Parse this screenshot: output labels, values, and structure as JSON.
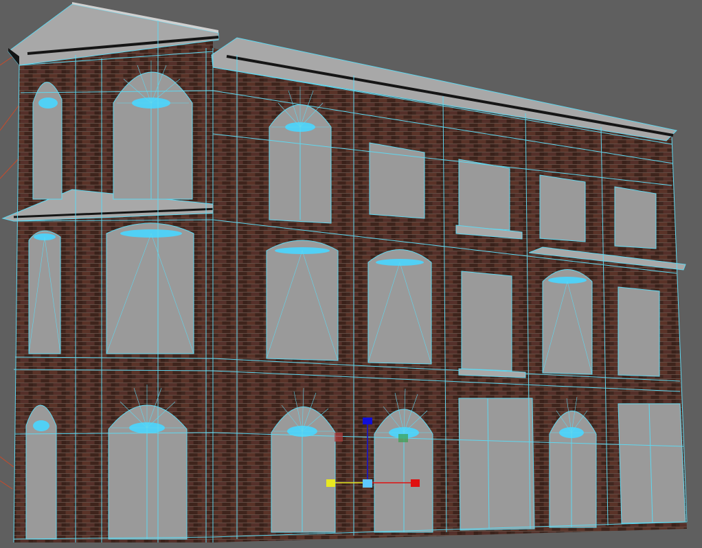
{
  "colors": {
    "background": "#5f5f5f",
    "brick": "#4a2b22",
    "brick_dark": "#2f1a14",
    "mortar": "#6b5a50",
    "glass": "#9a9a9a",
    "wire": "#5fd8f0",
    "highlight": "#49d6ff",
    "trim": "#a8a8a8",
    "trim_dark": "#151515",
    "gizmo_x": "#e01010",
    "gizmo_y": "#e8e820",
    "gizmo_z": "#1010d8",
    "gizmo_center": "#5fc8ff",
    "gizmo_plane_red": "#b03a3a",
    "gizmo_plane_green": "#3aa050",
    "guide_line": "#c84a2a"
  },
  "icons": {
    "gizmo": "transform-gizmo-icon"
  }
}
